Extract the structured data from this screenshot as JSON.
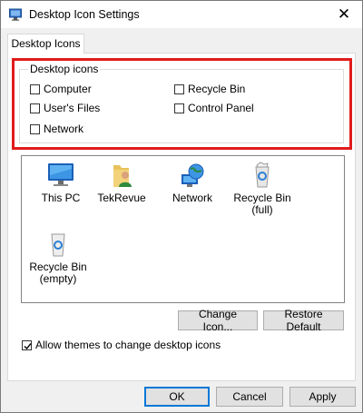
{
  "window": {
    "title": "Desktop Icon Settings",
    "close_glyph": "✕"
  },
  "tabs": [
    {
      "label": "Desktop Icons",
      "active": true
    }
  ],
  "desktop_icons_group": {
    "label": "Desktop icons",
    "highlight_color": "#e11b1b",
    "checkboxes": [
      {
        "label": "Computer",
        "checked": false
      },
      {
        "label": "Recycle Bin",
        "checked": false
      },
      {
        "label": "User's Files",
        "checked": false
      },
      {
        "label": "Control Panel",
        "checked": false
      },
      {
        "label": "Network",
        "checked": false
      }
    ]
  },
  "icon_list": [
    {
      "label": "This PC",
      "icon": "monitor-icon"
    },
    {
      "label": "TekRevue",
      "icon": "user-folder-icon"
    },
    {
      "label": "Network",
      "icon": "network-globe-icon"
    },
    {
      "label": "Recycle Bin\n(full)",
      "icon": "recycle-bin-full-icon"
    },
    {
      "label": "Recycle Bin\n(empty)",
      "icon": "recycle-bin-empty-icon"
    }
  ],
  "icon_buttons": {
    "change_icon": "Change Icon...",
    "restore_default": "Restore Default"
  },
  "allow_themes": {
    "label": "Allow themes to change desktop icons",
    "checked": true
  },
  "dialog_buttons": {
    "ok": "OK",
    "cancel": "Cancel",
    "apply": "Apply"
  },
  "colors": {
    "accent": "#0078d7",
    "highlight": "#e11b1b"
  }
}
